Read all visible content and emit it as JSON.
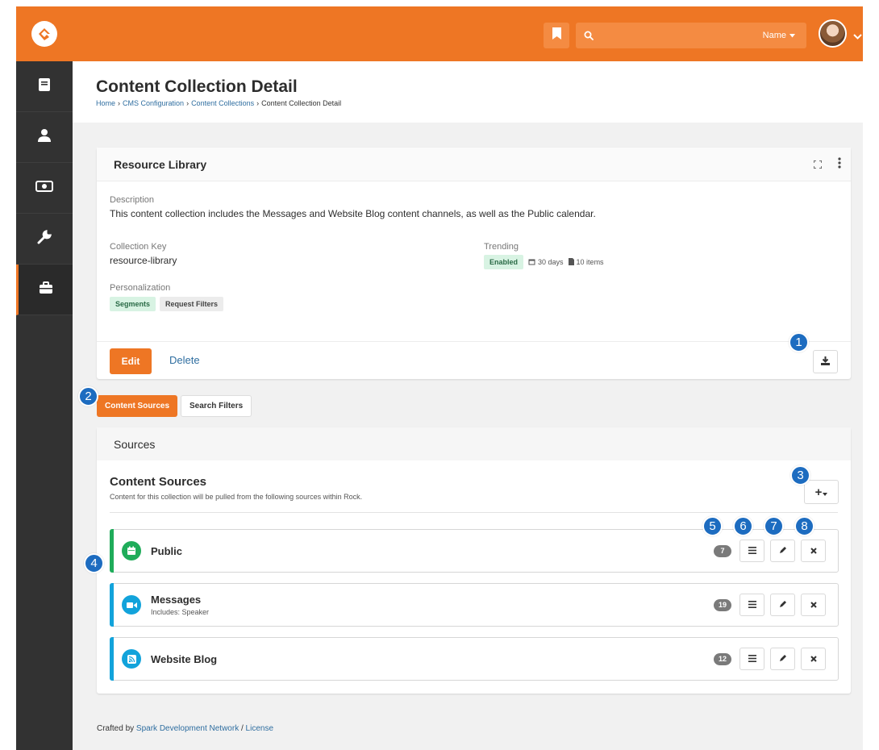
{
  "header": {
    "search_placeholder": "",
    "search_scope": "Name"
  },
  "page": {
    "title": "Content Collection Detail",
    "breadcrumb": [
      "Home",
      "CMS Configuration",
      "Content Collections",
      "Content Collection Detail"
    ]
  },
  "detail": {
    "panel_title": "Resource Library",
    "description_label": "Description",
    "description": "This content collection includes the Messages and Website Blog content channels, as well as the Public calendar.",
    "key_label": "Collection Key",
    "key": "resource-library",
    "trending_label": "Trending",
    "trending_status": "Enabled",
    "trending_days": "30 days",
    "trending_items": "10 items",
    "personalization_label": "Personalization",
    "personalization": [
      "Segments",
      "Request Filters"
    ],
    "edit_label": "Edit",
    "delete_label": "Delete"
  },
  "tabs": [
    "Content Sources",
    "Search Filters"
  ],
  "sources": {
    "panel_title": "Sources",
    "title": "Content Sources",
    "description": "Content for this collection will be pulled from the following sources within Rock.",
    "add_label": "+",
    "items": [
      {
        "name": "Public",
        "subtitle": "",
        "count": "7",
        "color": "#1fac5a",
        "icon": "calendar-icon"
      },
      {
        "name": "Messages",
        "subtitle": "Includes: Speaker",
        "count": "19",
        "color": "#12a3db",
        "icon": "video-icon"
      },
      {
        "name": "Website Blog",
        "subtitle": "",
        "count": "12",
        "color": "#12a3db",
        "icon": "rss-icon"
      }
    ]
  },
  "callouts": [
    "1",
    "2",
    "3",
    "4",
    "5",
    "6",
    "7",
    "8"
  ],
  "footer": {
    "prefix": "Crafted by",
    "org": "Spark Development Network",
    "separator": "/",
    "license": "License"
  },
  "colors": {
    "accent": "#ee7624",
    "sidebar": "#323232",
    "callout": "#1d6cc0",
    "link": "#2f6ea0"
  }
}
